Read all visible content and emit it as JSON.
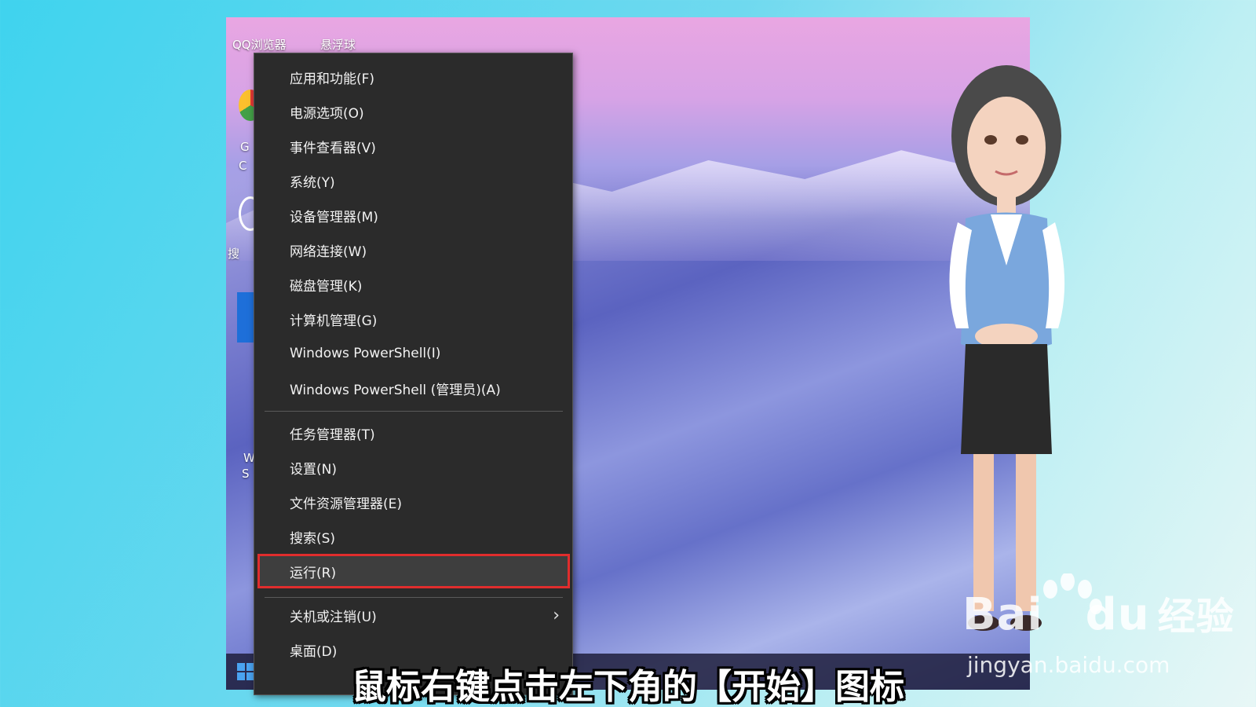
{
  "desktop": {
    "icons": [
      {
        "label": "QQ浏览器"
      },
      {
        "label": "悬浮球"
      },
      {
        "label": "G"
      },
      {
        "label": "C"
      },
      {
        "label": "搜"
      },
      {
        "label": "W"
      },
      {
        "label": "S"
      }
    ]
  },
  "context_menu": {
    "items": [
      {
        "label": "应用和功能(F)"
      },
      {
        "label": "电源选项(O)"
      },
      {
        "label": "事件查看器(V)"
      },
      {
        "label": "系统(Y)"
      },
      {
        "label": "设备管理器(M)"
      },
      {
        "label": "网络连接(W)"
      },
      {
        "label": "磁盘管理(K)"
      },
      {
        "label": "计算机管理(G)"
      },
      {
        "label": "Windows PowerShell(I)"
      },
      {
        "label": "Windows PowerShell (管理员)(A)"
      },
      {
        "label": "任务管理器(T)"
      },
      {
        "label": "设置(N)"
      },
      {
        "label": "文件资源管理器(E)"
      },
      {
        "label": "搜索(S)"
      },
      {
        "label": "运行(R)"
      },
      {
        "label": "关机或注销(U)"
      },
      {
        "label": "桌面(D)"
      }
    ],
    "highlighted": "运行(R)",
    "highlight_color": "#e02d2d"
  },
  "watermark": {
    "logo_text": "Bai",
    "logo_text2": "du",
    "logo_cn": "经验",
    "url": "jingyan.baidu.com"
  },
  "subtitle": "鼠标右键点击左下角的【开始】图标"
}
